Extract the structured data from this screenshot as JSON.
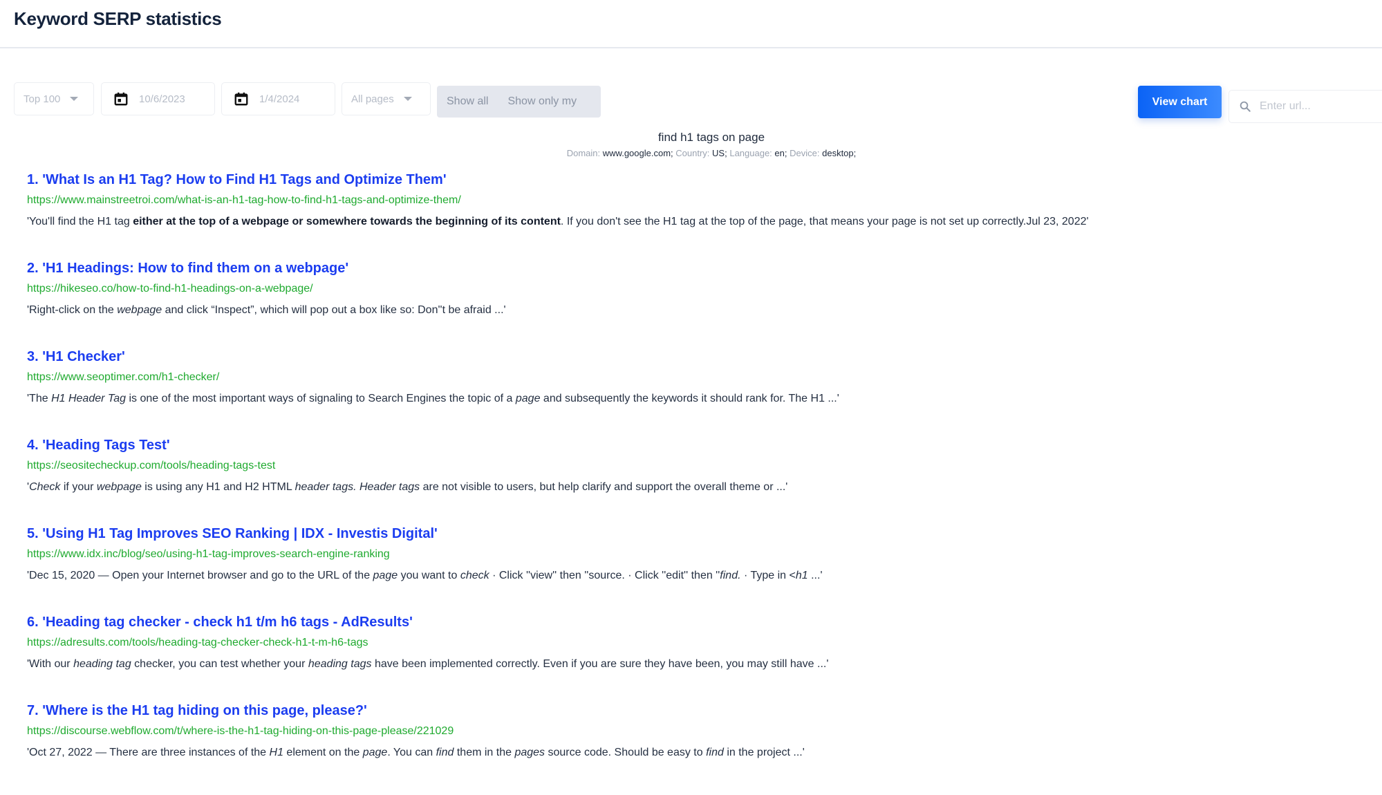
{
  "header": {
    "title": "Keyword SERP statistics"
  },
  "filters": {
    "top_select": "Top 100",
    "date_from": "10/6/2023",
    "date_to": "1/4/2024",
    "pages_select": "All pages",
    "toggle": {
      "show_all": "Show all",
      "show_only_my": "Show only my"
    },
    "view_chart": "View chart",
    "url_placeholder": "Enter url..."
  },
  "query": {
    "keyword": "find h1 tags on page",
    "meta": [
      {
        "key": "Domain:",
        "value": "www.google.com;"
      },
      {
        "key": "Country:",
        "value": "US;"
      },
      {
        "key": "Language:",
        "value": "en;"
      },
      {
        "key": "Device:",
        "value": "desktop;"
      }
    ]
  },
  "colors": {
    "accent": "#0b63f6",
    "title_link": "#1b3df0",
    "url": "#1faa2f"
  },
  "results": [
    {
      "title": "1. 'What Is an H1 Tag? How to Find H1 Tags and Optimize Them'",
      "url": "https://www.mainstreetroi.com/what-is-an-h1-tag-how-to-find-h1-tags-and-optimize-them/",
      "snippet": [
        {
          "t": "'You'll find the H1 tag "
        },
        {
          "t": "either at the top of a webpage or somewhere towards the beginning of its content",
          "b": true
        },
        {
          "t": ". If you don't see the H1 tag at the top of the page, that means your page is not set up correctly.Jul 23, 2022'"
        }
      ]
    },
    {
      "title": "2. 'H1 Headings: How to find them on a webpage'",
      "url": "https://hikeseo.co/how-to-find-h1-headings-on-a-webpage/",
      "snippet": [
        {
          "t": "'Right-click on the "
        },
        {
          "t": "webpage",
          "i": true
        },
        {
          "t": " and click “Inspect”, which will pop out a box like so: Don''t be afraid ...'"
        }
      ]
    },
    {
      "title": "3. 'H1 Checker'",
      "url": "https://www.seoptimer.com/h1-checker/",
      "snippet": [
        {
          "t": "'The "
        },
        {
          "t": "H1 Header Tag",
          "i": true
        },
        {
          "t": " is one of the most important ways of signaling to Search Engines the topic of a "
        },
        {
          "t": "page",
          "i": true
        },
        {
          "t": " and subsequently the keywords it should rank for. The H1 ...'"
        }
      ]
    },
    {
      "title": "4. 'Heading Tags Test'",
      "url": "https://seositecheckup.com/tools/heading-tags-test",
      "snippet": [
        {
          "t": "'"
        },
        {
          "t": "Check",
          "i": true
        },
        {
          "t": " if your "
        },
        {
          "t": "webpage",
          "i": true
        },
        {
          "t": " is using any H1 and H2 HTML "
        },
        {
          "t": "header tags. Header tags",
          "i": true
        },
        {
          "t": " are not visible to users, but help clarify and support the overall theme or ...'"
        }
      ]
    },
    {
      "title": "5. 'Using H1 Tag Improves SEO Ranking | IDX - Investis Digital'",
      "url": "https://www.idx.inc/blog/seo/using-h1-tag-improves-search-engine-ranking",
      "snippet": [
        {
          "t": "'Dec 15, 2020 — Open your Internet browser and go to the URL of the "
        },
        {
          "t": "page",
          "i": true
        },
        {
          "t": " you want to "
        },
        {
          "t": "check",
          "i": true
        },
        {
          "t": " · Click ''view'' then ''source. · Click ''edit'' then ''"
        },
        {
          "t": "find.",
          "i": true
        },
        {
          "t": " · Type in <"
        },
        {
          "t": "h1",
          "i": true
        },
        {
          "t": " ...'"
        }
      ]
    },
    {
      "title": "6. 'Heading tag checker - check h1 t/m h6 tags - AdResults'",
      "url": "https://adresults.com/tools/heading-tag-checker-check-h1-t-m-h6-tags",
      "snippet": [
        {
          "t": "'With our "
        },
        {
          "t": "heading tag",
          "i": true
        },
        {
          "t": " checker, you can test whether your "
        },
        {
          "t": "heading tags",
          "i": true
        },
        {
          "t": " have been implemented correctly. Even if you are sure they have been, you may still have ...'"
        }
      ]
    },
    {
      "title": "7. 'Where is the H1 tag hiding on this page, please?'",
      "url": "https://discourse.webflow.com/t/where-is-the-h1-tag-hiding-on-this-page-please/221029",
      "snippet": [
        {
          "t": "'Oct 27, 2022 — There are three instances of the "
        },
        {
          "t": "H1",
          "i": true
        },
        {
          "t": " element on the "
        },
        {
          "t": "page",
          "i": true
        },
        {
          "t": ". You can "
        },
        {
          "t": "find",
          "i": true
        },
        {
          "t": " them in the "
        },
        {
          "t": "pages",
          "i": true
        },
        {
          "t": " source code. Should be easy to "
        },
        {
          "t": "find",
          "i": true
        },
        {
          "t": " in the project ...'"
        }
      ]
    }
  ]
}
